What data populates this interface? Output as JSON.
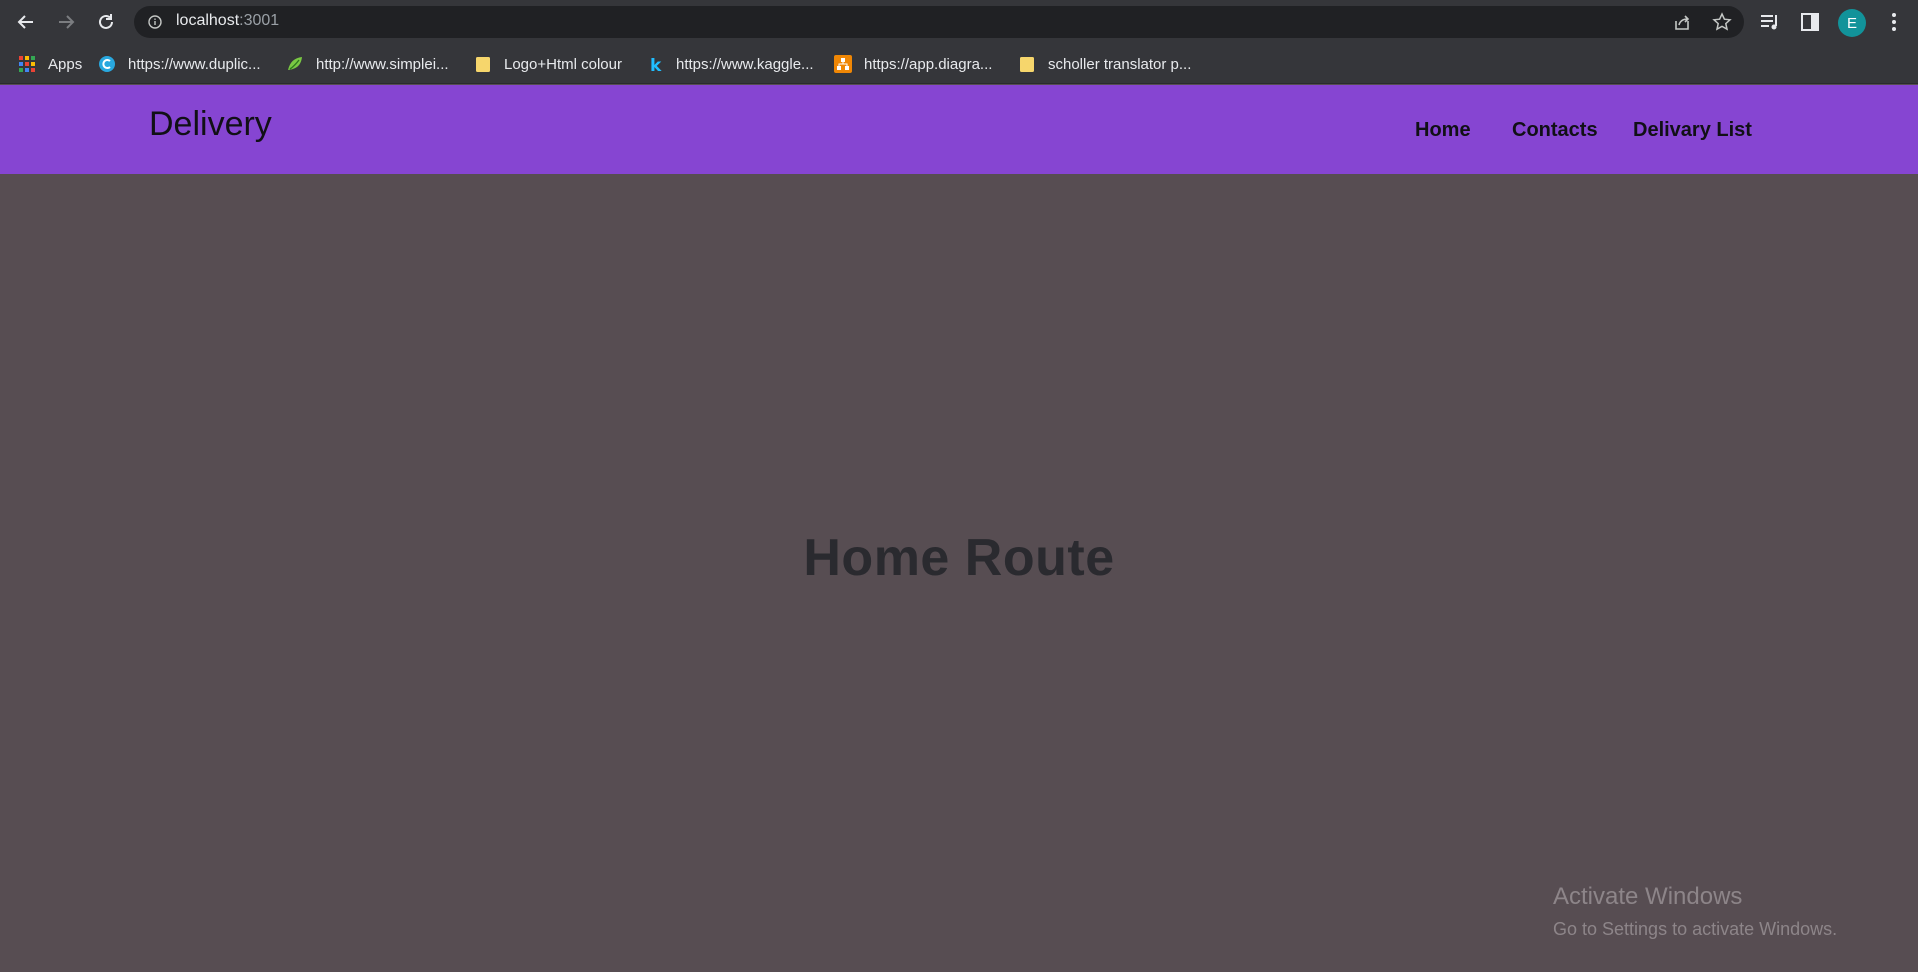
{
  "browser": {
    "url_host": "localhost",
    "url_port": ":3001",
    "avatar_letter": "E",
    "accent_avatar": "#12939a",
    "bookmarks": [
      {
        "label": "Apps",
        "icon": "apps-grid-icon"
      },
      {
        "label": "https://www.duplic...",
        "icon": "duplichecker-icon"
      },
      {
        "label": "http://www.simplei...",
        "icon": "simplei-icon"
      },
      {
        "label": "Logo+Html colour",
        "icon": "folder-icon"
      },
      {
        "label": "https://www.kaggle...",
        "icon": "kaggle-icon"
      },
      {
        "label": "https://app.diagra...",
        "icon": "diagrams-icon"
      },
      {
        "label": "scholler translator p...",
        "icon": "folder-icon"
      }
    ]
  },
  "navbar": {
    "brand": "Delivery",
    "color": "#8645d2",
    "links": [
      "Home",
      "Contacts",
      "Delivary List"
    ]
  },
  "main": {
    "heading": "Home Route",
    "background": "#574d52"
  },
  "watermark": {
    "title": "Activate Windows",
    "subtitle": "Go to Settings to activate Windows."
  }
}
